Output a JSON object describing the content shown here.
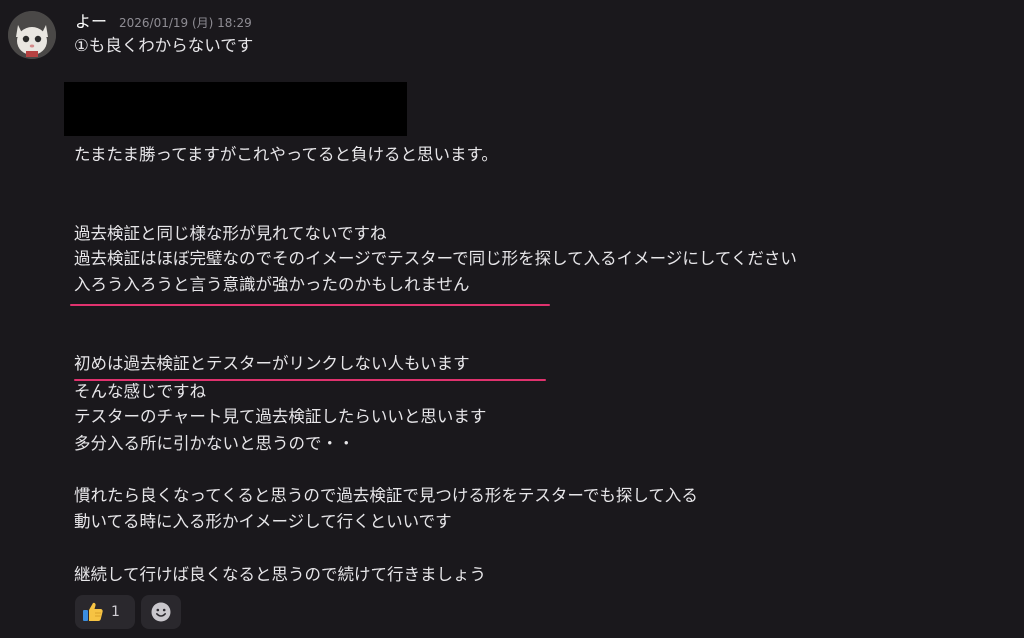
{
  "message": {
    "author": "よー",
    "timestamp": "2026/01/19 (月) 18:29",
    "lines": [
      "①も良くわからないです",
      "たまたま勝ってますがこれやってると負けると思います。",
      "過去検証と同じ様な形が見れてないですね",
      "過去検証はほぼ完璧なのでそのイメージでテスターで同じ形を探して入るイメージにしてください",
      "入ろう入ろうと言う意識が強かったのかもしれません",
      "初めは過去検証とテスターがリンクしない人もいます",
      "そんな感じですね",
      "テスターのチャート見て過去検証したらいいと思います",
      "多分入る所に引かないと思うので・・",
      "慣れたら良くなってくると思うので過去検証で見つける形をテスターでも探して入る",
      "動いてる時に入る形かイメージして行くといいです",
      "継続して行けば良くなると思うので続けて行きましょう"
    ]
  },
  "reactions": {
    "thumbs_up_icon": "thumbs-up-icon",
    "thumbs_up_count": "1",
    "add_reaction_icon": "smiley-icon"
  },
  "colors": {
    "background": "#1a181c",
    "text": "#e7e6e9",
    "timestamp": "#8f8d94",
    "underline": "#e0326e",
    "redaction": "#000000",
    "reaction_bg": "#2a282d"
  }
}
